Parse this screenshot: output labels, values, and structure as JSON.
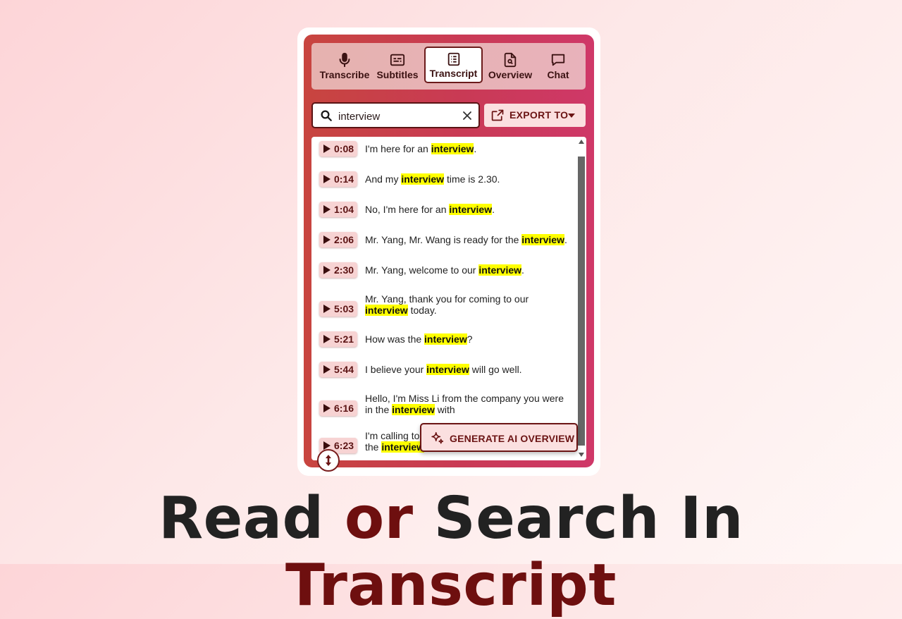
{
  "tabs": [
    {
      "label": "Transcribe",
      "icon": "microphone-icon"
    },
    {
      "label": "Subtitles",
      "icon": "subtitles-icon"
    },
    {
      "label": "Transcript",
      "icon": "transcript-icon",
      "active": true
    },
    {
      "label": "Overview",
      "icon": "document-search-icon"
    },
    {
      "label": "Chat",
      "icon": "chat-bubble-icon"
    }
  ],
  "search": {
    "value": "interview",
    "icon": "search-icon",
    "clear_icon": "close-icon"
  },
  "export": {
    "label": "EXPORT TO",
    "icon": "share-icon",
    "caret": "caret-down-icon"
  },
  "transcript": [
    {
      "time": "0:08",
      "before": "I'm here for an ",
      "match": "interview",
      "after": "."
    },
    {
      "time": "0:14",
      "before": "And my ",
      "match": "interview",
      "after": " time is 2.30."
    },
    {
      "time": "1:04",
      "before": "No, I'm here for an ",
      "match": "interview",
      "after": "."
    },
    {
      "time": "2:06",
      "before": "Mr. Yang, Mr. Wang is ready for the ",
      "match": "interview",
      "after": "."
    },
    {
      "time": "2:30",
      "before": "Mr. Yang, welcome to our ",
      "match": "interview",
      "after": "."
    },
    {
      "time": "5:03",
      "before": "Mr. Yang, thank you for coming to our ",
      "match": "interview",
      "after": " today."
    },
    {
      "time": "5:21",
      "before": "How was the ",
      "match": "interview",
      "after": "?"
    },
    {
      "time": "5:44",
      "before": "I believe your ",
      "match": "interview",
      "after": " will go well."
    },
    {
      "time": "6:16",
      "before": "Hello, I'm Miss Li from the company you were in the ",
      "match": "interview",
      "after": " with"
    },
    {
      "time": "6:23",
      "before": "I'm calling to ",
      "match": "",
      "after": "",
      "line2_before": "the ",
      "line2_match": "interview"
    }
  ],
  "generate_button": {
    "label": "GENERATE AI OVERVIEW",
    "icon": "sparkle-icon"
  },
  "resize_handle": {
    "icon": "vertical-resize-icon"
  },
  "headline": {
    "part1": "Read ",
    "part2": "or",
    "part3": " Search In ",
    "part4": "Transcript"
  },
  "colors": {
    "accent": "#6e0f0f",
    "highlight": "#ffff00",
    "panel_gradient_start": "#c8453f",
    "panel_gradient_end": "#cf3868"
  }
}
